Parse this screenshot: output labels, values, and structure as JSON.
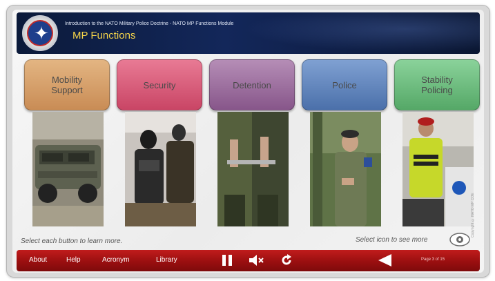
{
  "header": {
    "subtitle": "Introduction to the NATO Military Police Doctrine - NATO MP Functions Module",
    "title": "MP Functions"
  },
  "functions": [
    {
      "label": "Mobility\nSupport",
      "color": "#d8a06a",
      "photo": "military-vehicle"
    },
    {
      "label": "Security",
      "color": "#d65a78",
      "photo": "armed-security-personnel"
    },
    {
      "label": "Detention",
      "color": "#9b6a9c",
      "photo": "handcuffed-detainee"
    },
    {
      "label": "Police",
      "color": "#5f86bf",
      "photo": "military-police-officer"
    },
    {
      "label": "Stability\nPolicing",
      "color": "#6fbf7f",
      "photo": "military-police-vest"
    }
  ],
  "instructions": {
    "left": "Select each button to learn more.",
    "right": "Select icon to see more"
  },
  "footer": {
    "nav": [
      "About",
      "Help",
      "Acronym",
      "Library"
    ],
    "page_indicator": "Page 3 of 15",
    "icons": [
      "pause-icon",
      "mute-icon",
      "replay-icon",
      "back-icon"
    ]
  },
  "side_note": "Copyright © NATO MP COE",
  "colors": {
    "header_bg": "#13275a",
    "title_yellow": "#f3d34a",
    "footer_red": "#b01818"
  }
}
